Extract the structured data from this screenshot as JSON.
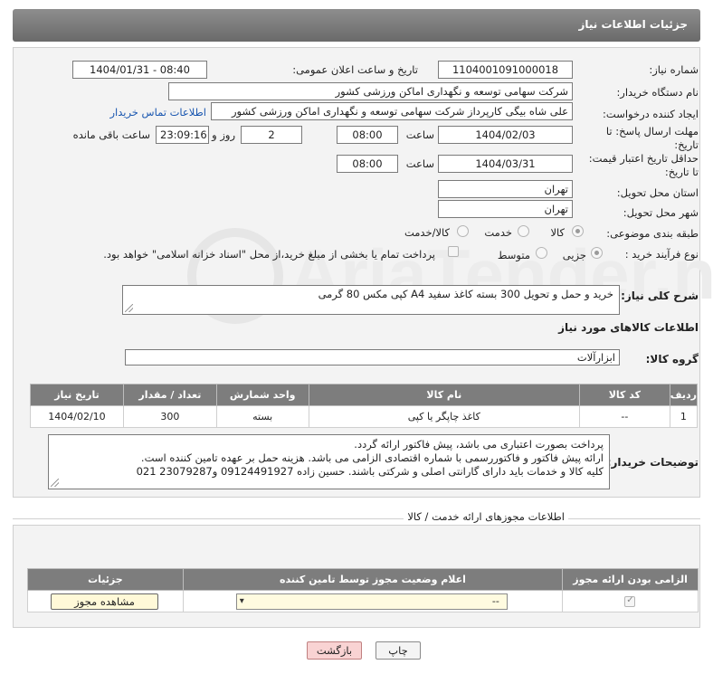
{
  "header": {
    "title": "جزئیات اطلاعات نیاز"
  },
  "form": {
    "need_number_label": "شماره نیاز:",
    "need_number": "1104001091000018",
    "announce_label": "تاریخ و ساعت اعلان عمومی:",
    "announce_value": "1404/01/31 - 08:40",
    "buyer_org_label": "نام دستگاه خریدار:",
    "buyer_org": "شرکت سهامی توسعه و نگهداری اماکن ورزشی کشور",
    "requester_label": "ایجاد کننده درخواست:",
    "requester": "علی شاه بیگی کارپرداز شرکت سهامی توسعه و نگهداری اماکن ورزشی کشور",
    "contact_link": "اطلاعات تماس خریدار",
    "deadline_label_1": "مهلت ارسال پاسخ: تا",
    "deadline_label_2": "تاریخ:",
    "deadline_date": "1404/02/03",
    "time_label": "ساعت",
    "deadline_time": "08:00",
    "days_value": "2",
    "days_label": "روز و",
    "remaining_time": "23:09:16",
    "remaining_label": "ساعت باقی مانده",
    "validity_label_1": "حداقل تاریخ اعتبار قیمت:",
    "validity_label_2": "تا تاریخ:",
    "validity_date": "1404/03/31",
    "validity_time": "08:00",
    "province_label": "استان محل تحویل:",
    "province": "تهران",
    "city_label": "شهر محل تحویل:",
    "city": "تهران",
    "category_label": "طبقه بندی موضوعی:",
    "category_options": [
      "کالا",
      "خدمت",
      "کالا/خدمت"
    ],
    "process_label": "نوع فرآیند خرید :",
    "process_options": [
      "جزیی",
      "متوسط"
    ],
    "payment_note": "پرداخت تمام یا بخشی از مبلغ خرید،از محل \"اسناد خزانه اسلامی\" خواهد بود.",
    "summary_label": "شرح کلی نیاز:",
    "summary": "خرید و حمل و تحویل 300 بسته کاغذ سفید A4 کپی مکس 80 گرمی",
    "goods_info_title": "اطلاعات کالاهای مورد نیاز",
    "goods_group_label": "گروه کالا:",
    "goods_group": "ابزارآلات"
  },
  "goods_table": {
    "headers": [
      "ردیف",
      "کد کالا",
      "نام کالا",
      "واحد شمارش",
      "تعداد / مقدار",
      "تاریخ نیاز"
    ],
    "rows": [
      [
        "1",
        "--",
        "کاغذ چاپگر یا کپی",
        "بسته",
        "300",
        "1404/02/10"
      ]
    ]
  },
  "buyer_notes": {
    "label": "توضیحات خریدار:",
    "lines": [
      "پرداخت بصورت اعتباری می باشد، پیش فاکتور ارائه گردد.",
      "ارائه پیش فاکتور و فاکتوررسمی با شماره اقتصادی الزامی می باشد. هزینه حمل بر عهده تامین کننده است.",
      "کلیه کالا و خدمات باید دارای گارانتی اصلی و شرکتی باشند. حسین زاده 09124491927 و23079287 021"
    ]
  },
  "permits": {
    "title": "اطلاعات مجوزهای ارائه خدمت / کالا",
    "headers": [
      "الزامی بودن ارائه مجوز",
      "اعلام وضعیت مجوز توسط تامین کننده",
      "جزئیات"
    ],
    "select_value": "--",
    "view_button": "مشاهده مجوز"
  },
  "buttons": {
    "print": "چاپ",
    "back": "بازگشت"
  },
  "watermark": "AriaTender.neT",
  "colors": {
    "header": "#7a7a7a",
    "link": "#1a57b0",
    "back_button": "#f9d3d3",
    "view_button": "#fff9d8"
  }
}
